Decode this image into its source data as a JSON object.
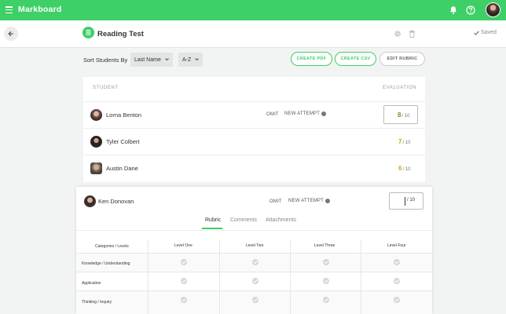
{
  "app": {
    "brand": "Markboard"
  },
  "header": {
    "test_title": "Reading Test",
    "saved_label": "Saved"
  },
  "toolbar": {
    "sort_label": "Sort Students By",
    "sort_field": "Last Name",
    "sort_order": "A-Z",
    "create_pdf": "CREATE PDF",
    "create_csv": "CREATE CSV",
    "edit_rubric": "EDIT RUBRIC"
  },
  "table": {
    "col_student": "STUDENT",
    "col_evaluation": "EVALUATION",
    "omit_label": "OMIT",
    "new_attempt_label": "NEW ATTEMPT",
    "denominator": "/ 10",
    "rows": [
      {
        "name": "Lorna Benton",
        "score": "8",
        "score_color": "#6a9a1f"
      },
      {
        "name": "Tyler Colbert",
        "score": "7",
        "score_color": "#c9a21a"
      },
      {
        "name": "Austin Dane",
        "score": "6",
        "score_color": "#d8a820"
      }
    ]
  },
  "expanded": {
    "name": "Ken Donovan",
    "omit_label": "OMIT",
    "new_attempt_label": "NEW ATTEMPT",
    "denominator": "/ 10",
    "tabs": [
      "Rubric",
      "Comments",
      "Attachments"
    ],
    "rubric": {
      "header": "Categories / Levels",
      "levels": [
        "Level One",
        "Level Two",
        "Level Three",
        "Level Four"
      ],
      "categories": [
        "Knowledge / Understanding",
        "Application",
        "Thinking / Inquiry"
      ]
    }
  },
  "colors": {
    "accent": "#3ecf67",
    "topbar": "#3ecf67"
  }
}
